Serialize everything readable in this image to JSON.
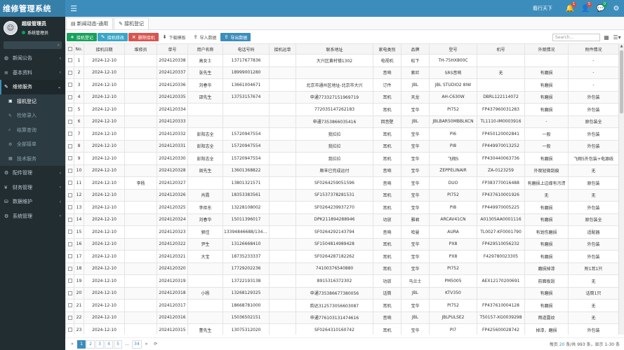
{
  "app": {
    "title": "维修管理系统"
  },
  "header": {
    "user": "裔行天下",
    "bell_badge": "1",
    "user_badge": "5",
    "chat_badge": "0"
  },
  "sidebar": {
    "user_name": "超级管理员",
    "user_role": "系统管理员",
    "menu": [
      {
        "label": "新闻公告",
        "icon": "globe-icon"
      },
      {
        "label": "基本资料",
        "icon": "list-icon"
      },
      {
        "label": "维修服务",
        "icon": "wrench-icon"
      }
    ],
    "submenu": [
      {
        "label": "接机登记"
      },
      {
        "label": "检修录入"
      },
      {
        "label": "结算查询"
      },
      {
        "label": "全部接单"
      },
      {
        "label": "技术服务"
      }
    ],
    "menu_after": [
      {
        "label": "配件管理"
      },
      {
        "label": "财务管理"
      },
      {
        "label": "数据维护"
      },
      {
        "label": "系统管理"
      }
    ]
  },
  "tabs": [
    {
      "label": "新闻动态-通用"
    },
    {
      "label": "接机登记"
    }
  ],
  "toolbar": {
    "add": "接机登记",
    "edit": "接机修改",
    "delete": "删除接机",
    "download": "下载模板",
    "import": "导入数据",
    "export": "导出数据",
    "search_placeholder": "Search..."
  },
  "table": {
    "columns": [
      "No.",
      "接机日期",
      "维修员",
      "单号",
      "用户名称",
      "电话号码",
      "接机运单",
      "联系地址",
      "家电类别",
      "品牌",
      "型号",
      "机号",
      "外观情况",
      "附件情况"
    ],
    "rows": [
      [
        "1",
        "2024-12-10",
        "",
        "2024120338",
        "高女士",
        "13717677836",
        "",
        "大兴区黄村镇1302",
        "电视机",
        "松下",
        "TH-75HX800C",
        "",
        "",
        "-"
      ],
      [
        "2",
        "2024-12-10",
        "",
        "2024120337",
        "张先生",
        "18999001280",
        "",
        "",
        "音响",
        "索尼",
        "SRS音响",
        "无",
        "有磨损",
        "-"
      ],
      [
        "3",
        "2024-12-10",
        "",
        "2024120336",
        "刘春华",
        "13661004671",
        "",
        "北京市通州区地址-北京市大兴",
        "订件",
        "JBL",
        "JBL STUDIO2 8IW",
        "",
        "有磨损",
        "-"
      ],
      [
        "4",
        "2024-12-10",
        "",
        "2024120335",
        "邵先生",
        "13753157674",
        "",
        "申通773327151969719",
        "耳机",
        "天龙",
        "AH-C630W",
        "DBRL122114072",
        "有磨损",
        "外包装"
      ],
      [
        "5",
        "2024-12-10",
        "",
        "2024120334",
        "",
        "",
        "",
        "772035147262183",
        "耳机",
        "宝华",
        "PI752",
        "FP437960031283",
        "有磨损",
        "外包装"
      ],
      [
        "6",
        "2024-12-10",
        "",
        "2024120333",
        "",
        "",
        "",
        "申通735386603541​6",
        "回音壁",
        "JBL",
        "JBLBAR50MBBLKCN",
        "TL1110-IM0003916",
        "-",
        "原包装全"
      ],
      [
        "7",
        "2024-12-10",
        "",
        "2024120332",
        "彭阳志全",
        "15720947554",
        "",
        "我拉拉",
        "耳机",
        "宝华",
        "PI6",
        "FP450120002841",
        "一般",
        "外包装"
      ],
      [
        "8",
        "2024-12-10",
        "",
        "2024120331",
        "彭阳志全",
        "15720947554",
        "",
        "我拉拉",
        "耳机",
        "宝华",
        "PI8",
        "FP449970013252",
        "一般",
        "外包装"
      ],
      [
        "9",
        "2024-12-10",
        "",
        "2024120330",
        "彭阳志全",
        "15720947554",
        "",
        "我拉拉",
        "耳机",
        "宝华",
        "飞翔5",
        "FP430440063736",
        "有磨损",
        "飞翔5外包装+电源线"
      ],
      [
        "10",
        "2024-12-10",
        "",
        "2024120328",
        "周先生",
        "13601368822",
        "",
        "顺丰已完成运付",
        "音响",
        "宝华",
        "ZEPPELINAIR",
        "ZA-0123259",
        "外观轻微刮痕",
        "无"
      ],
      [
        "11",
        "2024-12-10",
        "李杨",
        "2024120327",
        "",
        "13801321571",
        "",
        "SF0264259051596",
        "音响",
        "宝华",
        "DUO",
        "FP383770016488",
        "有磨损上边缘有污渍",
        "原包装"
      ],
      [
        "12",
        "2024-12-10",
        "",
        "2024120326",
        "肖霞",
        "18353383561",
        "",
        "SF1537378281531",
        "耳机",
        "宝华",
        "PI752",
        "FP437610001926",
        "无",
        "无"
      ],
      [
        "13",
        "2024-12-10",
        "",
        "2024120325",
        "李炬东",
        "13228108002",
        "",
        "SF0264239937270",
        "耳机",
        "宝华",
        "PI8",
        "FP449970005225",
        "有磨损",
        "外包装"
      ],
      [
        "14",
        "2024-12-10",
        "",
        "2024120324",
        "刘春华",
        "15011396017",
        "",
        "DPK211894288946",
        "功放",
        "雅君",
        "ARCAV41CN",
        "A01305AA0001116",
        "有磨损",
        "原包装全"
      ],
      [
        "15",
        "2024-12-10",
        "",
        "2024120323",
        "郭佳",
        "13394846688/134048…",
        "",
        "SF0264292143794",
        "音响",
        "哈曼",
        "AURA",
        "TL0027-KF0001790",
        "有划伤磨损",
        "适配器"
      ],
      [
        "16",
        "2024-12-10",
        "",
        "2024120322",
        "尹生",
        "13126668410",
        "",
        "SF1504814989428",
        "耳机",
        "宝华",
        "PX8",
        "FP429510056232",
        "有磨损",
        "外包装"
      ],
      [
        "17",
        "2024-12-10",
        "",
        "2024120321",
        "大宝",
        "18735233337",
        "",
        "SF0264287182262",
        "耳机",
        "宝华",
        "PX8",
        "F429780023305",
        "有磨损",
        "外包装"
      ],
      [
        "18",
        "2024-12-10",
        "",
        "2024120320",
        "",
        "17729202236",
        "",
        "74100376540880",
        "耳机",
        "宝华",
        "PI752",
        "",
        "磨损掉漆",
        "附1耳1只"
      ],
      [
        "19",
        "2024-12-10",
        "",
        "2024120319",
        "",
        "13722193138",
        "",
        "8915316372302",
        "功放",
        "马兰士",
        "PM5005",
        "AEX12170200691",
        "前面板刮",
        "无"
      ],
      [
        "20",
        "2024-12-10",
        "",
        "2024120318",
        "小杨",
        "13268129325",
        "",
        "申通735386677380056",
        "话筒",
        "JBL",
        "KTV350",
        "",
        "有磨损",
        "话筒1只"
      ],
      [
        "21",
        "2024-12-10",
        "",
        "2024120317",
        "",
        "18668781000",
        "",
        "韵达312573056603087",
        "耳机",
        "宝华",
        "PI752",
        "FP437610004128",
        "有磨损",
        "无"
      ],
      [
        "22",
        "2024-12-10",
        "",
        "2024120316",
        "",
        "15036502151",
        "",
        "申通776103131474616",
        "音响",
        "JBL",
        "JBLPULSE2",
        "T50157-XG0039298",
        "两道露纹",
        "无"
      ],
      [
        "23",
        "2024-12-10",
        "",
        "2024120315",
        "董先生",
        "13075312020",
        "",
        "SF0264310160742",
        "耳机",
        "宝华",
        "PI7",
        "FP425600028742",
        "掉漆，磨损",
        "外包装"
      ]
    ]
  },
  "pager": {
    "pages": [
      "1",
      "2",
      "3",
      "4",
      "5",
      "…",
      "34"
    ],
    "info_prefix": "每页",
    "page_size": "20",
    "info_suffix": "条/共 993 条，显示 1-30 条"
  },
  "colors": {
    "brand": "#3c8dbc",
    "sidebar": "#222d32"
  }
}
